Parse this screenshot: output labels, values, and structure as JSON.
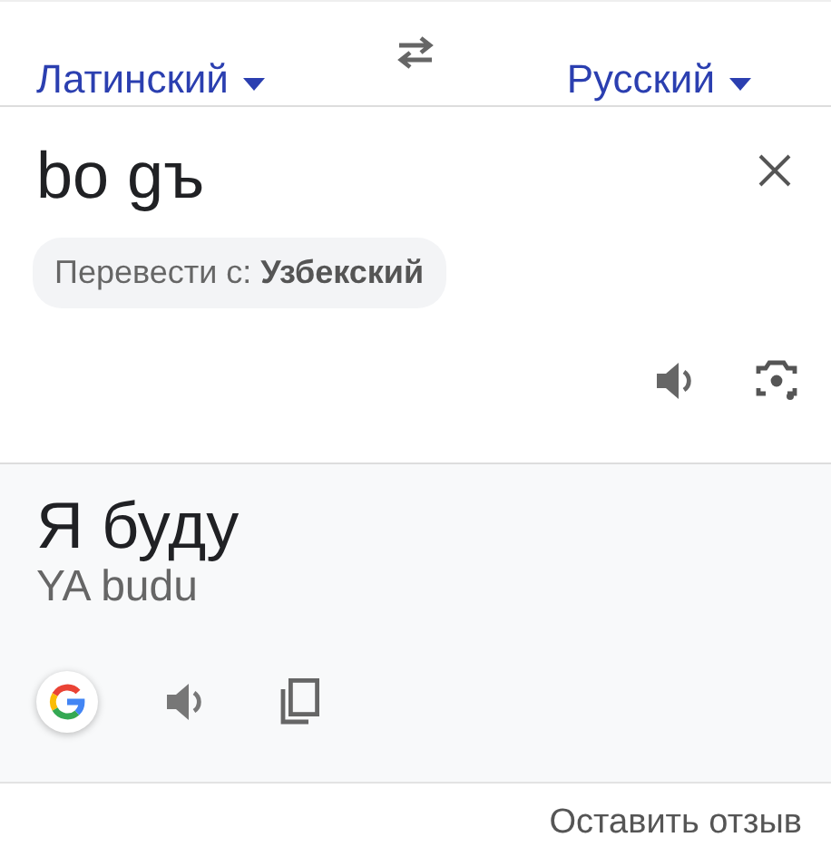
{
  "languages": {
    "source": "Латинский",
    "target": "Русский"
  },
  "input": {
    "text": "bo gъ"
  },
  "suggestion": "Перевести с: **Узбекский**",
  "output": {
    "text": "Я буду",
    "transliteration": "YA budu"
  },
  "feedback_link": "Оставить отзыв"
}
